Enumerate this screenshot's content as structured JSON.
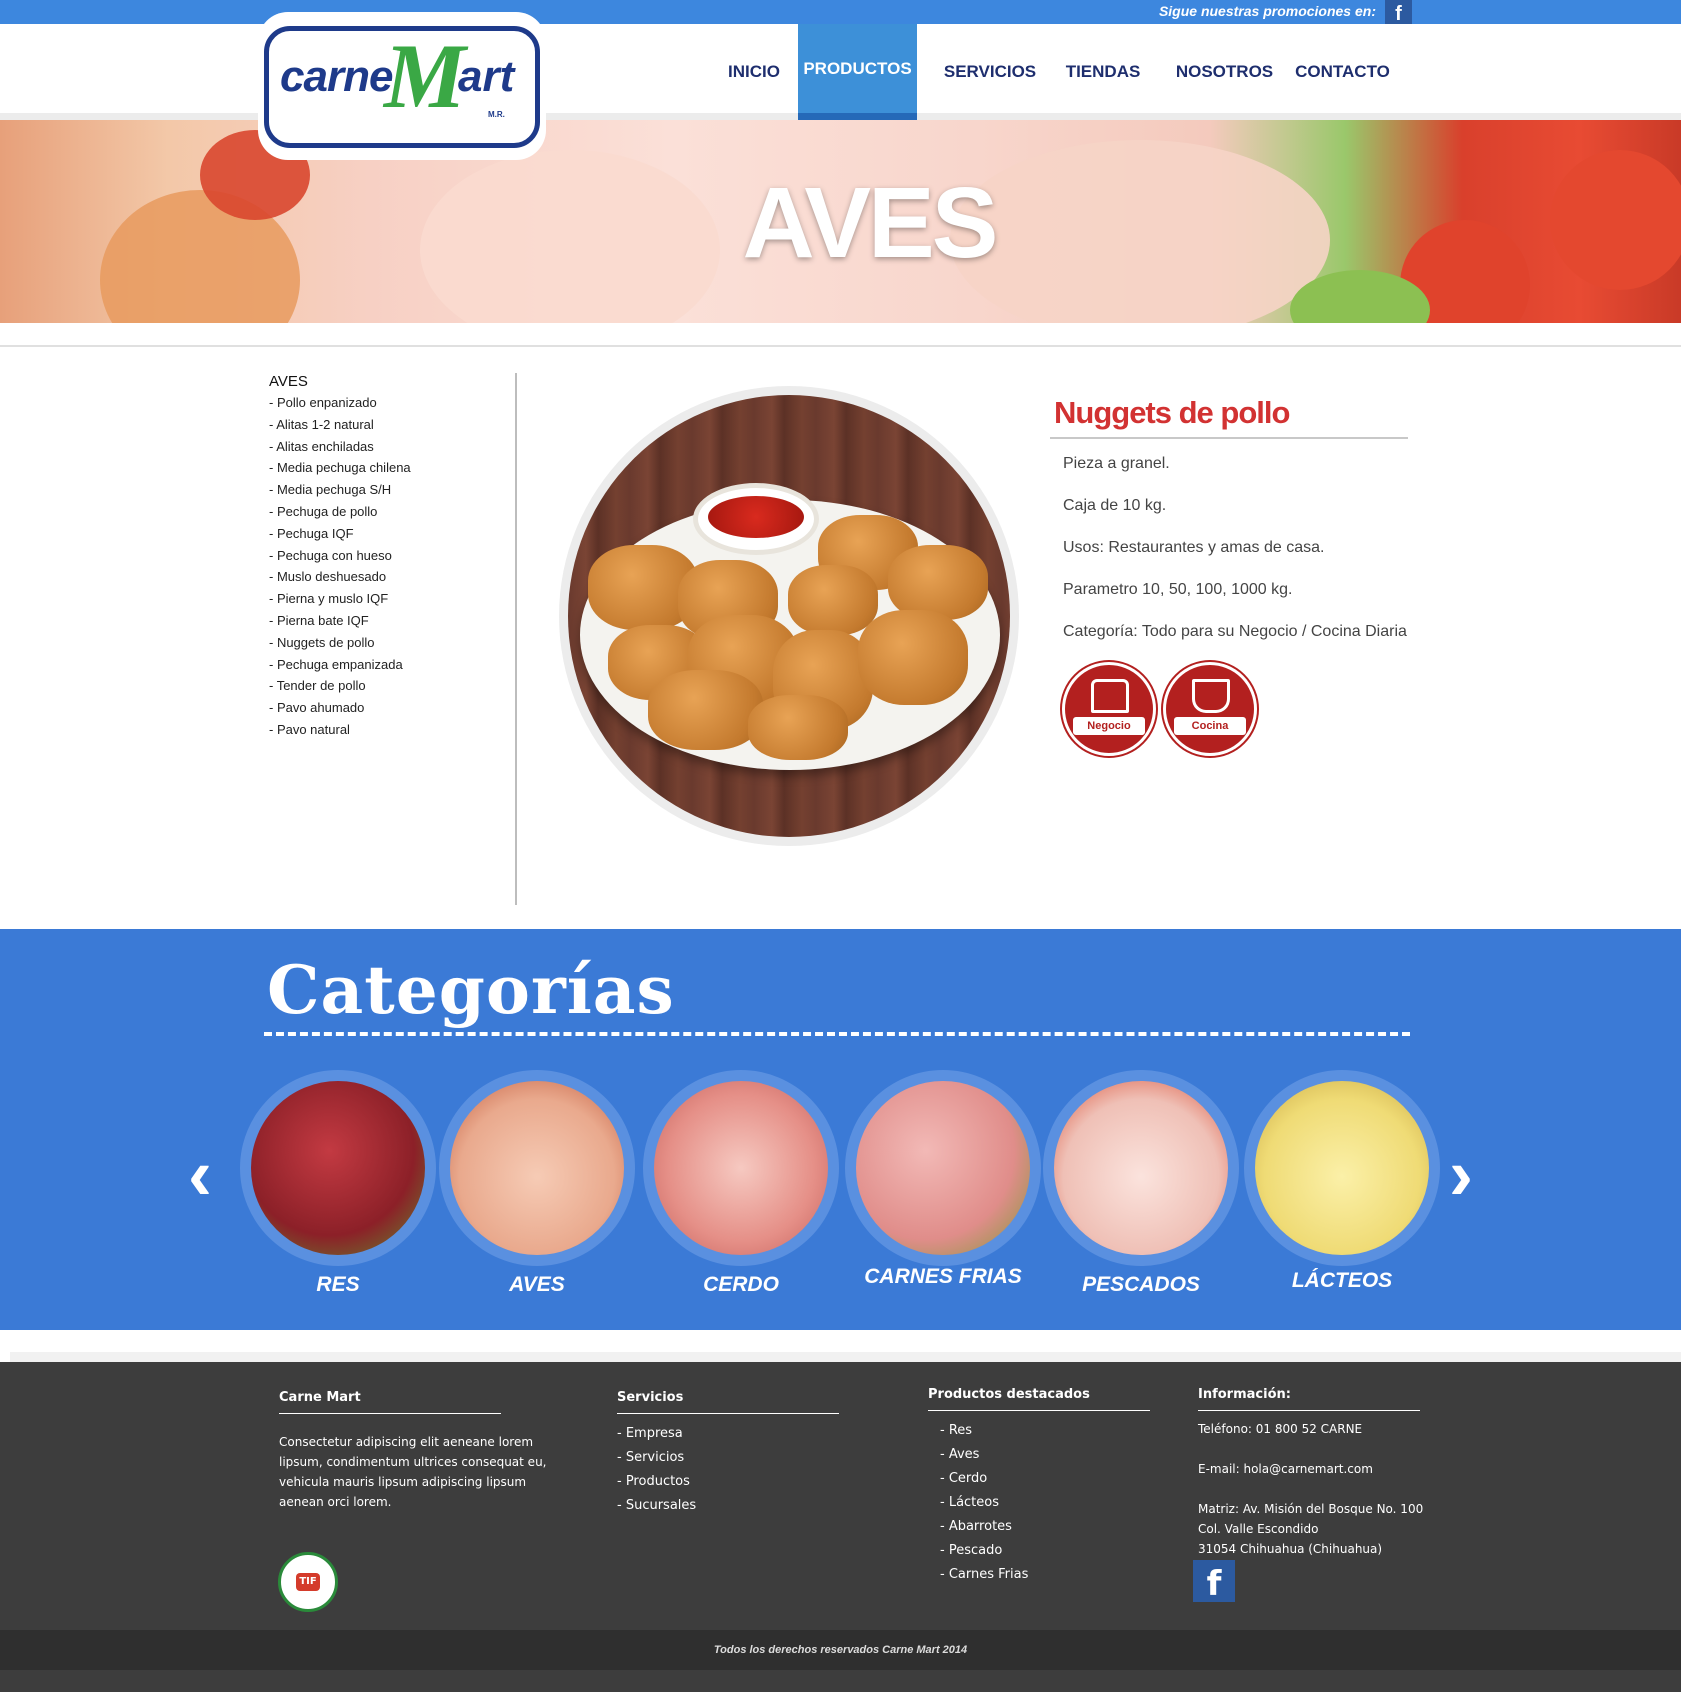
{
  "topbar": {
    "promo": "Sigue nuestras promociones en:",
    "fb_icon": "facebook-icon",
    "fb_glyph": "f"
  },
  "logo": {
    "carne": "carne",
    "m": "M",
    "art": "art",
    "mr": "M.R."
  },
  "nav": [
    {
      "label": "INICIO",
      "active": false
    },
    {
      "label": "PRODUCTOS",
      "active": true
    },
    {
      "label": "SERVICIOS",
      "active": false
    },
    {
      "label": "TIENDAS",
      "active": false
    },
    {
      "label": "NOSOTROS",
      "active": false
    },
    {
      "label": "CONTACTO",
      "active": false
    }
  ],
  "hero": {
    "title": "AVES"
  },
  "sidebar": {
    "title": "AVES",
    "items": [
      "- Pollo enpanizado",
      "- Alitas 1-2 natural",
      "- Alitas enchiladas",
      "- Media pechuga chilena",
      "- Media pechuga S/H",
      "- Pechuga de pollo",
      "- Pechuga IQF",
      "- Pechuga con hueso",
      "- Muslo deshuesado",
      "- Pierna y muslo IQF",
      "- Pierna bate IQF",
      "- Nuggets de pollo",
      "- Pechuga empanizada",
      "- Tender de pollo",
      "- Pavo ahumado",
      "- Pavo natural"
    ]
  },
  "product": {
    "name": "Nuggets de pollo",
    "details": [
      "Pieza a granel.",
      "Caja de 10 kg.",
      "Usos: Restaurantes y amas de casa.",
      "Parametro 10, 50, 100, 1000 kg.",
      "Categoría: Todo para su Negocio / Cocina Diaria"
    ],
    "badges": [
      {
        "label": "Negocio",
        "icon": "chef-hat-icon"
      },
      {
        "label": "Cocina",
        "icon": "cooking-pot-icon"
      }
    ]
  },
  "categories": {
    "title": "Categorías",
    "prev_glyph": "‹",
    "next_glyph": "›",
    "items": [
      {
        "name": "RES",
        "color": "#b8323a"
      },
      {
        "name": "AVES",
        "color": "#f0c0a8"
      },
      {
        "name": "CERDO",
        "color": "#e8a3a0"
      },
      {
        "name": "CARNES FRIAS",
        "color": "#e9a3a3"
      },
      {
        "name": "PESCADOS",
        "color": "#f3d2cc"
      },
      {
        "name": "LÁCTEOS",
        "color": "#f2e08a"
      }
    ]
  },
  "footer": {
    "about": {
      "title": "Carne Mart",
      "text": "Consectetur adipiscing elit aeneane lorem lipsum, condimentum ultrices consequat eu, vehicula mauris lipsum adipiscing lipsum aenean orci lorem.",
      "tif": "TIF"
    },
    "services": {
      "title": "Servicios",
      "items": [
        "- Empresa",
        "- Servicios",
        "- Productos",
        "- Sucursales"
      ]
    },
    "featured": {
      "title": "Productos destacados",
      "items": [
        "- Res",
        "- Aves",
        "- Cerdo",
        "- Lácteos",
        "- Abarrotes",
        "- Pescado",
        "- Carnes Frias"
      ]
    },
    "info": {
      "title": "Información:",
      "phone": "Teléfono: 01 800 52 CARNE",
      "email": "E-mail: hola@carnemart.com",
      "address1": "Matriz: Av. Misión del Bosque No. 100",
      "address2": "Col. Valle Escondido",
      "address3": "31054 Chihuahua (Chihuahua)",
      "fb_glyph": "f"
    },
    "copyright": "Todos los derechos reservados Carne Mart 2014"
  }
}
